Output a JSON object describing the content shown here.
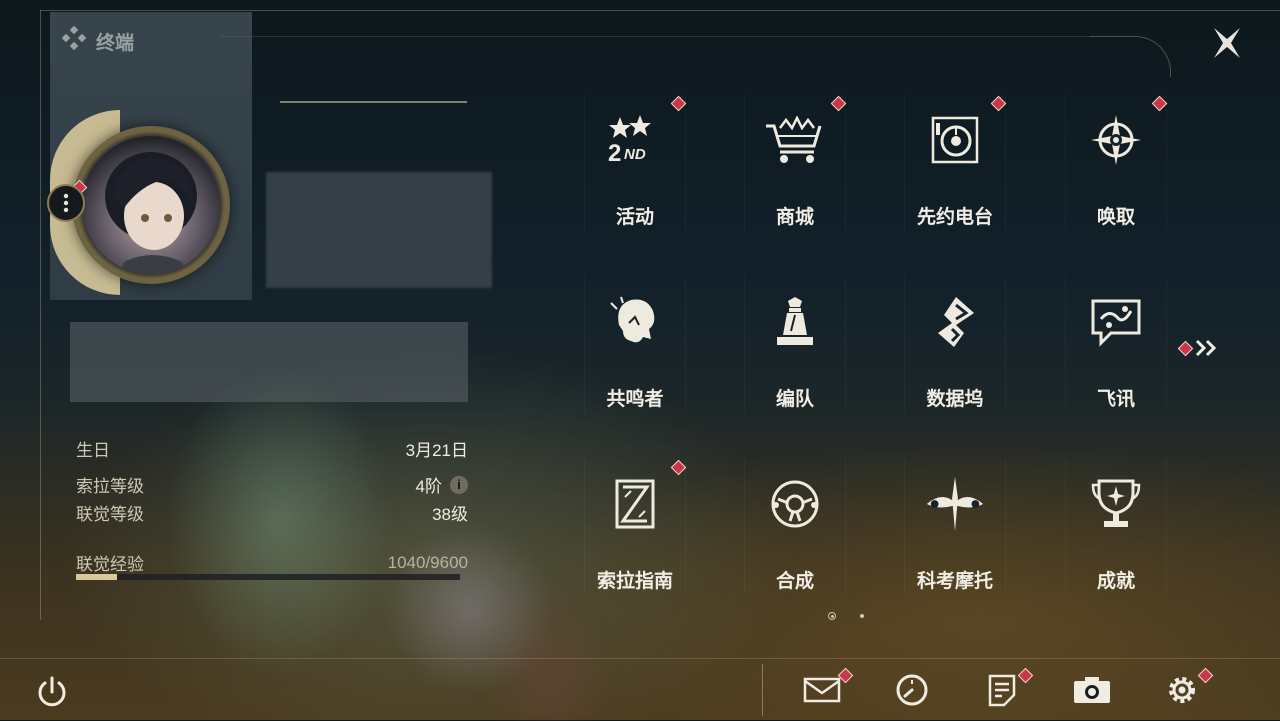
{
  "header": {
    "title": "终端"
  },
  "profile": {
    "birthday_label": "生日",
    "birthday_value": "3月21日",
    "sola_level_label": "索拉等级",
    "sola_level_value": "4阶",
    "union_level_label": "联觉等级",
    "union_level_value": "38级",
    "union_exp_label": "联觉经验",
    "union_exp_value": "1040/9600",
    "union_exp_fraction": 0.108
  },
  "menu": {
    "items": [
      {
        "label": "活动",
        "icon": "event-icon",
        "badge": true
      },
      {
        "label": "商城",
        "icon": "shop-icon",
        "badge": true
      },
      {
        "label": "先约电台",
        "icon": "radio-icon",
        "badge": true
      },
      {
        "label": "唤取",
        "icon": "convene-icon",
        "badge": true
      },
      {
        "label": "共鸣者",
        "icon": "resonator-icon",
        "badge": false
      },
      {
        "label": "编队",
        "icon": "team-icon",
        "badge": false
      },
      {
        "label": "数据坞",
        "icon": "data-bank-icon",
        "badge": false
      },
      {
        "label": "飞讯",
        "icon": "message-icon",
        "badge": false
      },
      {
        "label": "索拉指南",
        "icon": "guide-icon",
        "badge": true
      },
      {
        "label": "合成",
        "icon": "synthesis-icon",
        "badge": false
      },
      {
        "label": "科考摩托",
        "icon": "motorbike-icon",
        "badge": false
      },
      {
        "label": "成就",
        "icon": "achievement-icon",
        "badge": false
      }
    ]
  },
  "pagination": {
    "current": 1,
    "total": 2
  },
  "colors": {
    "accent": "#d8c99b",
    "badge": "#c8374a",
    "text": "#f2eee5"
  }
}
